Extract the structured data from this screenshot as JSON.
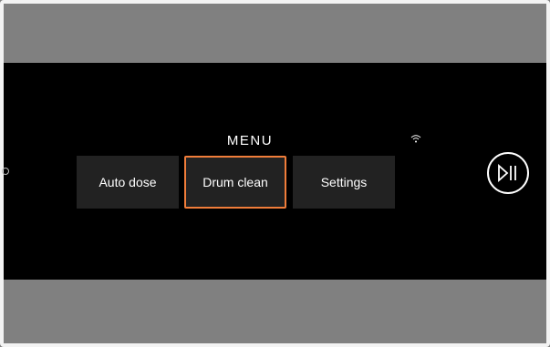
{
  "menu": {
    "title": "MENU",
    "items": [
      {
        "label": "Auto dose",
        "selected": false
      },
      {
        "label": "Drum clean",
        "selected": true
      },
      {
        "label": "Settings",
        "selected": false
      }
    ]
  },
  "status": {
    "wifi_icon": "wifi-icon"
  },
  "controls": {
    "play_pause_icon": "play-pause-icon"
  },
  "colors": {
    "selection": "#f07d3a",
    "button_bg": "#222222",
    "screen_bg": "#000000",
    "frame_bg": "#808080"
  }
}
